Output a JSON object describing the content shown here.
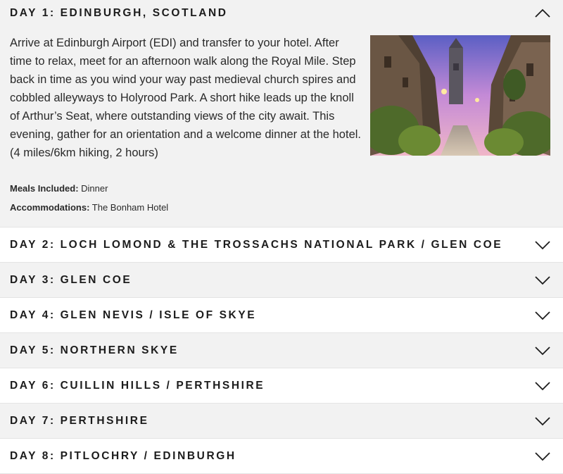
{
  "days": [
    {
      "title": "DAY 1: EDINBURGH, SCOTLAND",
      "expanded": true,
      "description": "Arrive at Edinburgh Airport (EDI) and transfer to your hotel. After time to relax, meet for an afternoon walk along the Royal Mile. Step back in time as you wind your way past medieval church spires and cobbled alleyways to Holyrood Park. A short hike leads up the knoll of Arthur’s Seat, where outstanding views of the city await. This evening, gather for an orientation and a welcome dinner at the hotel. (4 miles/6km hiking, 2 hours)",
      "meals_label": "Meals Included:",
      "meals_value": "Dinner",
      "accommodations_label": "Accommodations:",
      "accommodations_value": "The Bonham Hotel",
      "image_icon": "edinburgh-street-photo"
    },
    {
      "title": "DAY 2: LOCH LOMOND & THE TROSSACHS NATIONAL PARK / GLEN COE",
      "expanded": false
    },
    {
      "title": "DAY 3: GLEN COE",
      "expanded": false
    },
    {
      "title": "DAY 4: GLEN NEVIS / ISLE OF SKYE",
      "expanded": false
    },
    {
      "title": "DAY 5: NORTHERN SKYE",
      "expanded": false
    },
    {
      "title": "DAY 6: CUILLIN HILLS / PERTHSHIRE",
      "expanded": false
    },
    {
      "title": "DAY 7: PERTHSHIRE",
      "expanded": false
    },
    {
      "title": "DAY 8: PITLOCHRY / EDINBURGH",
      "expanded": false
    }
  ],
  "icons": {
    "collapse": "chevron-up-icon",
    "expand": "chevron-down-icon"
  },
  "colors": {
    "panel_gray": "#f2f2f2",
    "panel_white": "#ffffff",
    "text": "#1c1c1c"
  }
}
